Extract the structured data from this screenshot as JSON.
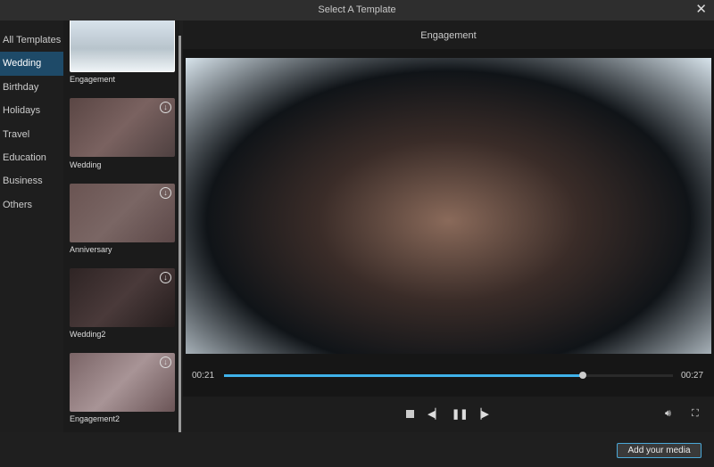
{
  "window": {
    "title": "Select A Template"
  },
  "sidebar": {
    "items": [
      {
        "label": "All Templates"
      },
      {
        "label": "Wedding",
        "active": true
      },
      {
        "label": "Birthday"
      },
      {
        "label": "Holidays"
      },
      {
        "label": "Travel"
      },
      {
        "label": "Education"
      },
      {
        "label": "Business"
      },
      {
        "label": "Others"
      }
    ]
  },
  "templates": [
    {
      "label": "Engagement",
      "selected": true,
      "download": false
    },
    {
      "label": "Wedding",
      "download": true
    },
    {
      "label": "Anniversary",
      "download": true
    },
    {
      "label": "Wedding2",
      "download": true
    },
    {
      "label": "Engagement2",
      "download": true
    }
  ],
  "preview": {
    "title": "Engagement",
    "current_time": "00:21",
    "total_time": "00:27",
    "progress": 0.8
  },
  "controls": {
    "icons": [
      "stop-icon",
      "previous-frame-icon",
      "pause-icon",
      "next-frame-icon",
      "volume-icon",
      "fullscreen-icon"
    ]
  },
  "footer": {
    "add_media_label": "Add your media"
  },
  "colors": {
    "accent": "#3fb2ea",
    "active_category": "#1e4a68"
  }
}
